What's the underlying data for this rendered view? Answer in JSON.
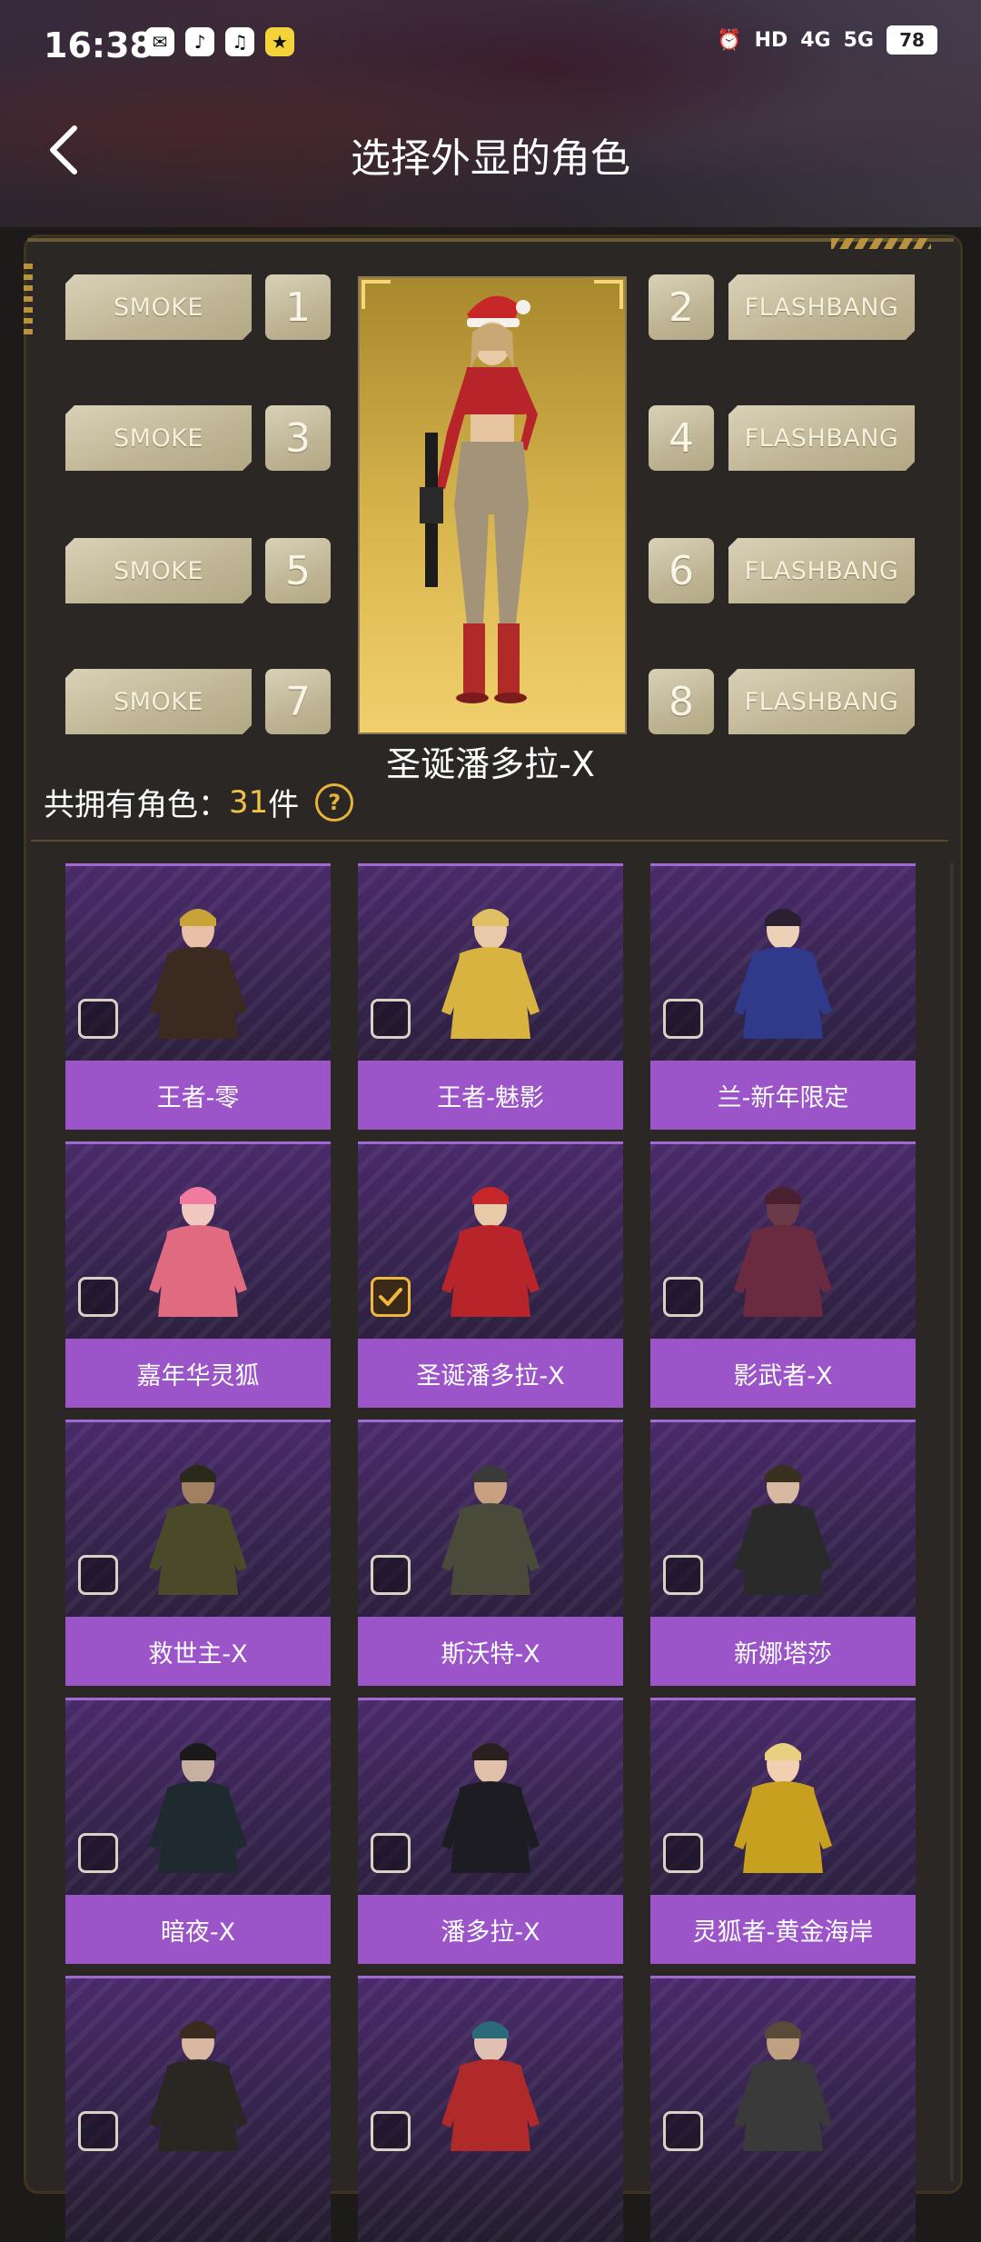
{
  "status_bar": {
    "time": "16:38",
    "network_1": "HD",
    "network_2": "4G",
    "network_3": "5G",
    "battery": "78"
  },
  "header": {
    "title": "选择外显的角色"
  },
  "loadout": {
    "slots": [
      {
        "num": "1",
        "label": "SMOKE"
      },
      {
        "num": "2",
        "label": "FLASHBANG"
      },
      {
        "num": "3",
        "label": "SMOKE"
      },
      {
        "num": "4",
        "label": "FLASHBANG"
      },
      {
        "num": "5",
        "label": "SMOKE"
      },
      {
        "num": "6",
        "label": "FLASHBANG"
      },
      {
        "num": "7",
        "label": "SMOKE"
      },
      {
        "num": "8",
        "label": "FLASHBANG"
      }
    ],
    "featured_character": "圣诞潘多拉-X"
  },
  "owned": {
    "prefix": "共拥有角色：",
    "count": "31",
    "suffix": "件",
    "help_symbol": "?"
  },
  "characters": [
    {
      "name": "王者-零",
      "checked": false
    },
    {
      "name": "王者-魅影",
      "checked": false
    },
    {
      "name": "兰-新年限定",
      "checked": false
    },
    {
      "name": "嘉年华灵狐",
      "checked": false
    },
    {
      "name": "圣诞潘多拉-X",
      "checked": true
    },
    {
      "name": "影武者-X",
      "checked": false
    },
    {
      "name": "救世主-X",
      "checked": false
    },
    {
      "name": "斯沃特-X",
      "checked": false
    },
    {
      "name": "新娜塔莎",
      "checked": false
    },
    {
      "name": "暗夜-X",
      "checked": false
    },
    {
      "name": "潘多拉-X",
      "checked": false
    },
    {
      "name": "灵狐者-黄金海岸",
      "checked": false
    },
    {
      "name": "",
      "checked": false
    },
    {
      "name": "",
      "checked": false
    },
    {
      "name": "",
      "checked": false
    }
  ],
  "colors": {
    "accent_gold": "#f1c04a",
    "card_label": "#9b55c9",
    "checked_border": "#f3b73a"
  }
}
